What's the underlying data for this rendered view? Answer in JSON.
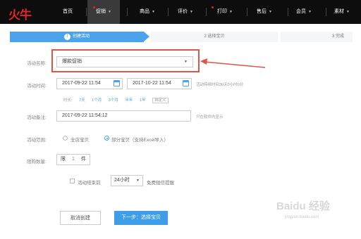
{
  "logo": {
    "text": "火牛",
    "color": "#e0242b"
  },
  "nav": {
    "items": [
      {
        "label": "首页",
        "caret": false,
        "dot": false
      },
      {
        "label": "促销",
        "caret": true,
        "dot": true
      },
      {
        "label": "商品",
        "caret": true,
        "dot": false
      },
      {
        "label": "评价",
        "caret": true,
        "dot": false
      },
      {
        "label": "打印",
        "caret": true,
        "dot": true
      },
      {
        "label": "售后",
        "caret": true,
        "dot": false
      },
      {
        "label": "会员",
        "caret": true,
        "dot": false
      },
      {
        "label": "素材",
        "caret": true,
        "dot": false
      }
    ],
    "active": "促销"
  },
  "steps": {
    "step1": {
      "num": "1",
      "label": "创建活动"
    },
    "step2": {
      "label": "2  选择宝贝"
    },
    "step3": {
      "label": "3  完成"
    }
  },
  "form": {
    "name_label": "活动名称:",
    "name_value": "爆款促销",
    "time_label": "活动时间:",
    "start_time": "2017-09-22 11:54",
    "end_time": "2017-10-22 11:54",
    "time_hint": "活动持续时间30天0小时0分",
    "quick": {
      "prefix": "时长:",
      "options": [
        "7天",
        "1个月",
        "3个月",
        "半年",
        "1年"
      ],
      "custom": "自定义"
    },
    "note_label": "活动备注:",
    "note_value": "2017-09-22 11:54:12",
    "note_hint": "只在软件内显示",
    "scope_label": "活动范围:",
    "scope_all": "全店宝贝",
    "scope_part": "部分宝贝（支持Excel导入）",
    "limit_label": "限购数量:",
    "limit_prefix": "限",
    "limit_value": "1",
    "limit_suffix": "件",
    "remind_label": "活动结束前",
    "remind_select": "24小时",
    "remind_hint": "免费短信提醒"
  },
  "buttons": {
    "cancel": "取消创建",
    "next": "下一步：选择宝贝"
  },
  "colors": {
    "accent": "#4aa3ec",
    "highlight": "#e2534a",
    "topbar": "#0d0d0d"
  },
  "watermark": {
    "text": "Baidu 经验",
    "sub": "jingyan.baidu.com"
  }
}
